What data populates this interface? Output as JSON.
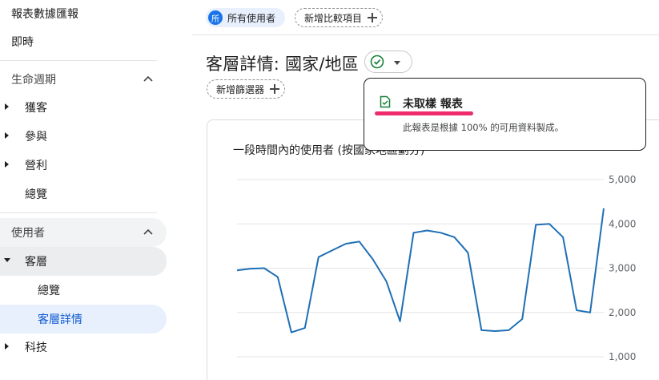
{
  "sidebar": {
    "reports_snapshot": "報表數據匯報",
    "realtime": "即時",
    "lifecycle": {
      "label": "生命週期",
      "items": [
        "獲客",
        "參與",
        "營利",
        "總覽"
      ]
    },
    "user": {
      "label": "使用者",
      "audience": {
        "label": "客層",
        "children": [
          "總覽",
          "客層詳情"
        ],
        "active": "客層詳情"
      },
      "tech": "科技"
    }
  },
  "topbar": {
    "segment_badge": "所",
    "segment_label": "所有使用者",
    "add_comparison": "新增比較項目"
  },
  "page": {
    "title": "客層詳情: 國家/地區",
    "add_filter": "新增篩選器"
  },
  "card": {
    "title": "一段時間內的使用者 (按國家",
    "title_tail": "地區劃分)"
  },
  "tooltip": {
    "title": "未取樣 報表",
    "description": "此報表是根據 100% 的可用資料製成。"
  },
  "colors": {
    "accent": "#1a73e8",
    "line": "#1f6fb5",
    "highlight": "#ee2c6d",
    "success": "#188038"
  },
  "icons": {
    "segment": "segment-badge",
    "check": "check-circle-icon",
    "report": "report-check-icon"
  },
  "chart_data": {
    "type": "line",
    "y_ticks": [
      "5,000",
      "4,000",
      "3,000",
      "2,000",
      "1,000"
    ],
    "ylim": [
      1000,
      5000
    ],
    "series": [
      {
        "values": [
          2950,
          2990,
          3000,
          2800,
          1550,
          1650,
          3250,
          3400,
          3550,
          3600,
          3200,
          2700,
          1800,
          3800,
          3850,
          3800,
          3700,
          3350,
          1600,
          1580,
          1600,
          1850,
          3980,
          4000,
          3700,
          2050,
          2000,
          4350
        ]
      }
    ]
  }
}
